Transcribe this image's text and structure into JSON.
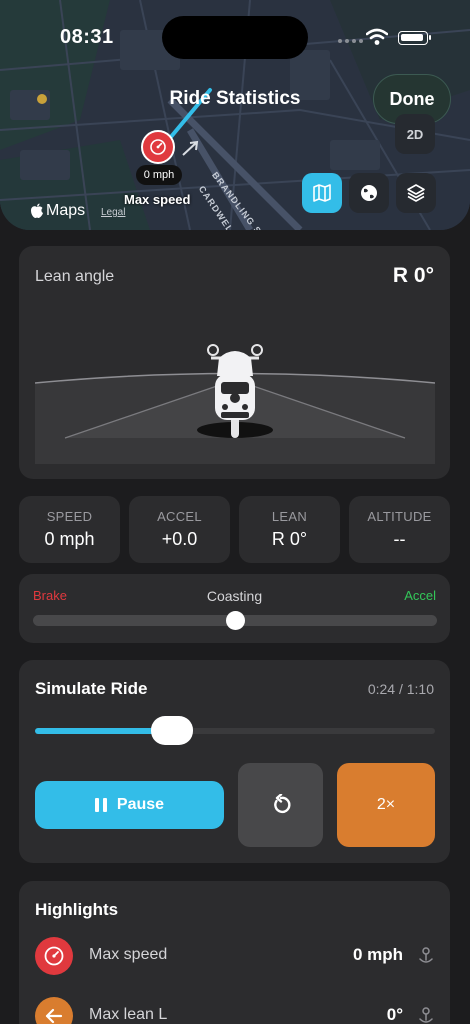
{
  "status_bar": {
    "time": "08:31"
  },
  "map": {
    "title": "Ride Statistics",
    "done_label": "Done",
    "view_2d_label": "2D",
    "pin_speed": "0 mph",
    "pin_caption": "Max speed",
    "maps_brand": "Maps",
    "legal_label": "Legal",
    "streets": [
      "BRANDLING STREET",
      "CARDWELL"
    ],
    "controls": [
      "map-icon",
      "globe-icon",
      "layers-icon"
    ]
  },
  "lean": {
    "label": "Lean angle",
    "value": "R 0°"
  },
  "stats": [
    {
      "label": "SPEED",
      "value": "0 mph"
    },
    {
      "label": "ACCEL",
      "value": "+0.0"
    },
    {
      "label": "LEAN",
      "value": "R 0°"
    },
    {
      "label": "ALTITUDE",
      "value": "--"
    }
  ],
  "accel_bar": {
    "brake_label": "Brake",
    "state_label": "Coasting",
    "accel_label": "Accel",
    "position": 0.5
  },
  "simulate": {
    "title": "Simulate Ride",
    "time": "0:24 / 1:10",
    "progress": 0.3429,
    "pause_label": "Pause",
    "speed_label": "2×"
  },
  "highlights": {
    "title": "Highlights",
    "items": [
      {
        "label": "Max speed",
        "value": "0 mph",
        "icon": "speedometer-icon",
        "color": "#e0393e"
      },
      {
        "label": "Max lean L",
        "value": "0°",
        "icon": "arrow-left-icon",
        "color": "#d97d2f"
      }
    ]
  },
  "colors": {
    "accent": "#33bde8",
    "brake": "#e0393e",
    "accel": "#33c759",
    "speed_button": "#d97d2f",
    "background": "#1c1c1e",
    "card": "#2c2c2e"
  }
}
